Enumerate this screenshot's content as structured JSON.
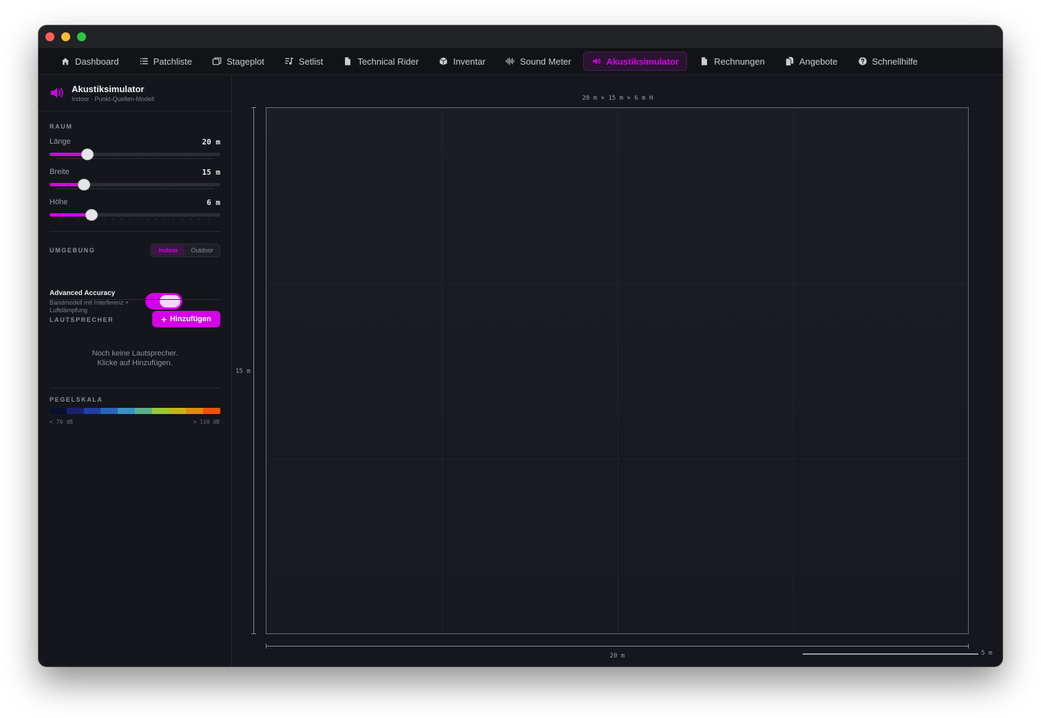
{
  "nav": {
    "items": [
      {
        "label": "Dashboard",
        "icon": "home-icon"
      },
      {
        "label": "Patchliste",
        "icon": "list-icon"
      },
      {
        "label": "Stageplot",
        "icon": "layers-icon"
      },
      {
        "label": "Setlist",
        "icon": "music-list-icon"
      },
      {
        "label": "Technical Rider",
        "icon": "document-icon"
      },
      {
        "label": "Inventar",
        "icon": "box-icon"
      },
      {
        "label": "Sound Meter",
        "icon": "waveform-icon"
      },
      {
        "label": "Akustiksimulator",
        "icon": "speaker-icon",
        "active": true
      },
      {
        "label": "Rechnungen",
        "icon": "document-icon"
      },
      {
        "label": "Angebote",
        "icon": "documents-icon"
      },
      {
        "label": "Schnellhilfe",
        "icon": "help-icon"
      }
    ]
  },
  "sidebar": {
    "title": "Akustiksimulator",
    "subtitle": "Indoor · Punkt-Quellen-Modell",
    "room": {
      "section_label": "RAUM",
      "length": {
        "label": "Länge",
        "value": "20 m",
        "fraction": 0.22
      },
      "width": {
        "label": "Breite",
        "value": "15 m",
        "fraction": 0.2
      },
      "height": {
        "label": "Höhe",
        "value": "6 m",
        "fraction": 0.245
      }
    },
    "environment": {
      "section_label": "UMGEBUNG",
      "options": [
        "Indoor",
        "Outdoor"
      ],
      "selected": "Indoor",
      "advanced_title": "Advanced Accuracy",
      "advanced_desc": "Bandmodell mit Interferenz + Luftdämpfung",
      "advanced_on": true
    },
    "speakers": {
      "section_label": "LAUTSPRECHER",
      "add_label": "Hinzufügen",
      "empty_line1": "Noch keine Lautsprecher.",
      "empty_line2": "Klicke auf Hinzufügen."
    },
    "scale": {
      "section_label": "PEGELSKALA",
      "min_label": "< 70 dB",
      "max_label": "> 110 dB",
      "colors": [
        "#0b0f2e",
        "#1a2170",
        "#233ea0",
        "#2a64b8",
        "#3a91c4",
        "#5fae8c",
        "#9ac53a",
        "#c4b320",
        "#e08a18",
        "#f0520c"
      ]
    }
  },
  "canvas": {
    "dims_label": "20 m × 15 m × 6 m H",
    "height_label": "15 m",
    "width_label": "20 m",
    "scale_label": "5 m"
  },
  "colors": {
    "accent": "#d400e6"
  }
}
